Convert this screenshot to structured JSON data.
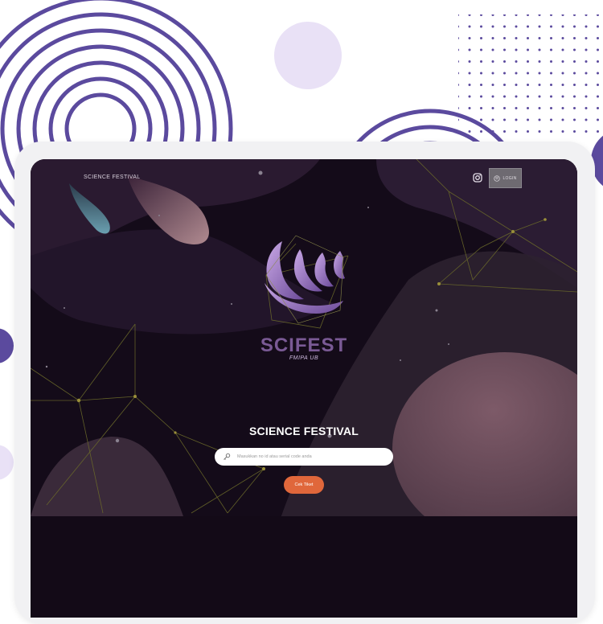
{
  "navbar": {
    "brand": "SCIENCE FESTIVAL",
    "instagram_icon": "instagram-icon",
    "login_icon": "user-circle-icon",
    "login_label": "LOGIN"
  },
  "logo": {
    "wordmark": "SCIFEST",
    "subtitle": "FMIPA UB"
  },
  "hero": {
    "title": "SCIENCE FESTIVAL",
    "search_icon": "key-icon",
    "search_placeholder": "Masukkan no id atau serial code anda",
    "button_label": "Cek Tiket"
  },
  "colors": {
    "accent_purple": "#5b4a9e",
    "light_purple": "#e9e1f6",
    "screen_bg": "#140b19",
    "button_orange": "#e0673b"
  }
}
